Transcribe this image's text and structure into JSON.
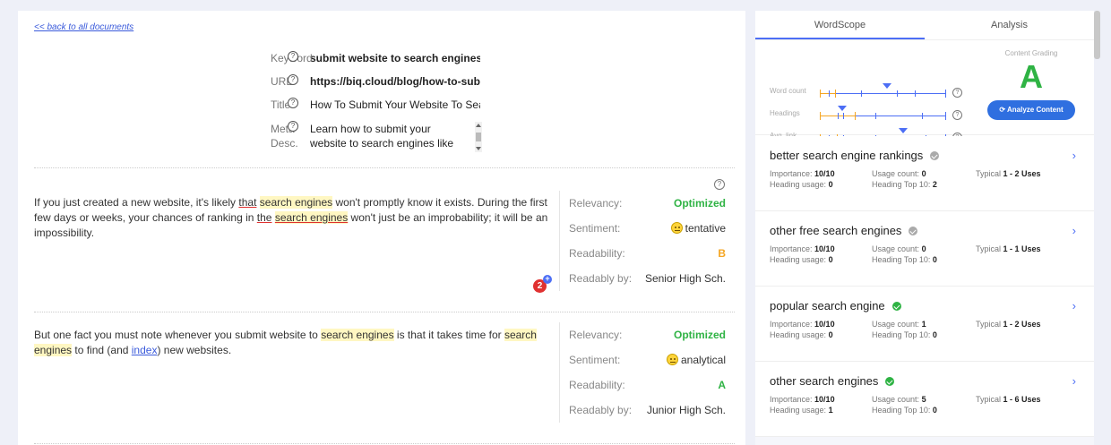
{
  "back_link": "<< back to all documents",
  "meta": {
    "keyword_label": "Keyword",
    "keyword_value": "submit website to search engines",
    "url_label": "URL",
    "url_value": "https://biq.cloud/blog/how-to-submi",
    "title_label": "Title",
    "title_value": "How To Submit Your Website To Sea",
    "desc_label": "Meta Desc.",
    "desc_value": "Learn how to submit your website to search engines like Google,",
    "help": "?"
  },
  "paragraphs": [
    {
      "p1": "If you just created a new website, it's likely ",
      "p2": "that",
      "p3": " ",
      "p4": "search engines",
      "p5": " won't promptly know it exists. During the first few days or weeks, your chances of ranking in ",
      "p6": "the",
      "p7": " ",
      "p8": "search engines",
      "p9": " won't just be an improbability; it will be an impossibility.",
      "stats": {
        "relevancy_label": "Relevancy:",
        "relevancy": "Optimized",
        "sentiment_label": "Sentiment:",
        "sentiment": "tentative",
        "readability_label": "Readability:",
        "readability": "B",
        "readably_label": "Readably by:",
        "readably": "Senior High Sch."
      },
      "badge": "2"
    },
    {
      "p1": "But one fact you must note whenever you submit website to ",
      "p2": "search engines",
      "p3": " is that it takes time for ",
      "p4": "search engines",
      "p5": " to find (and ",
      "p6": "index",
      "p7": ") new websites.",
      "stats": {
        "relevancy_label": "Relevancy:",
        "relevancy": "Optimized",
        "sentiment_label": "Sentiment:",
        "sentiment": "analytical",
        "readability_label": "Readability:",
        "readability": "A",
        "readably_label": "Readably by:",
        "readably": "Junior High Sch."
      }
    }
  ],
  "sidebar": {
    "tabs": [
      "WordScope",
      "Analysis"
    ],
    "graph_labels": [
      "Word count",
      "Headings",
      "Avg. link"
    ],
    "grading_label": "Content Grading",
    "grade": "A",
    "analyze_button": "Analyze Content",
    "keywords": [
      {
        "title": "better search engine rankings",
        "status": "gray",
        "importance_label": "Importance:",
        "importance": "10/10",
        "usage_label": "Usage count:",
        "usage": "0",
        "typical_label": "Typical",
        "typical": "1 - 2 Uses",
        "heading_label": "Heading usage:",
        "heading": "0",
        "top10_label": "Heading Top 10:",
        "top10": "2"
      },
      {
        "title": "other free search engines",
        "status": "gray",
        "importance_label": "Importance:",
        "importance": "10/10",
        "usage_label": "Usage count:",
        "usage": "0",
        "typical_label": "Typical",
        "typical": "1 - 1 Uses",
        "heading_label": "Heading usage:",
        "heading": "0",
        "top10_label": "Heading Top 10:",
        "top10": "0"
      },
      {
        "title": "popular search engine",
        "status": "green",
        "importance_label": "Importance:",
        "importance": "10/10",
        "usage_label": "Usage count:",
        "usage": "1",
        "typical_label": "Typical",
        "typical": "1 - 2 Uses",
        "heading_label": "Heading usage:",
        "heading": "0",
        "top10_label": "Heading Top 10:",
        "top10": "0"
      },
      {
        "title": "other search engines",
        "status": "green",
        "importance_label": "Importance:",
        "importance": "10/10",
        "usage_label": "Usage count:",
        "usage": "5",
        "typical_label": "Typical",
        "typical": "1 - 6 Uses",
        "heading_label": "Heading usage:",
        "heading": "1",
        "top10_label": "Heading Top 10:",
        "top10": "0"
      }
    ]
  },
  "colors": {
    "accent": "#4c6ef5",
    "green": "#2fb344",
    "orange": "#f5a623",
    "highlight": "#fff7c2",
    "badge": "#e03131"
  }
}
